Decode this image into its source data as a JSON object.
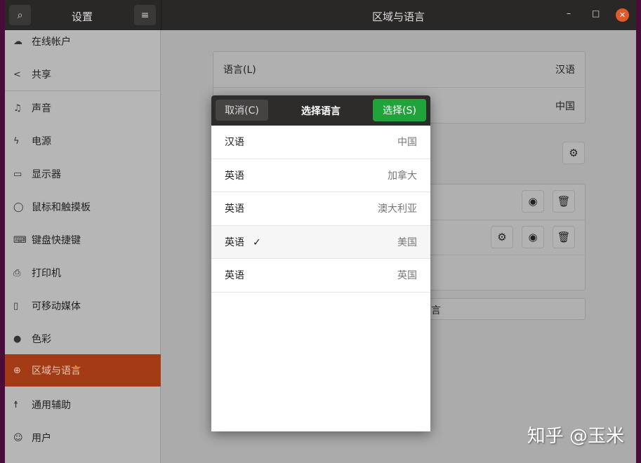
{
  "header": {
    "sidebar_title": "设置",
    "title": "区域与语言",
    "minimize": "–",
    "maximize": "□",
    "close": "✕"
  },
  "sidebar": {
    "items": [
      {
        "label": "在线帐户",
        "icon": "cloud-icon",
        "glyph": "☁"
      },
      {
        "label": "共享",
        "icon": "share-icon",
        "glyph": "<"
      },
      {
        "label": "声音",
        "icon": "music-note-icon",
        "glyph": "♫"
      },
      {
        "label": "电源",
        "icon": "power-icon",
        "glyph": "ϟ"
      },
      {
        "label": "显示器",
        "icon": "display-icon",
        "glyph": "▭"
      },
      {
        "label": "鼠标和触摸板",
        "icon": "mouse-icon",
        "glyph": "◯"
      },
      {
        "label": "键盘快捷键",
        "icon": "keyboard-icon",
        "glyph": "⌨"
      },
      {
        "label": "打印机",
        "icon": "printer-icon",
        "glyph": "⎙"
      },
      {
        "label": "可移动媒体",
        "icon": "removable-media-icon",
        "glyph": "▯"
      },
      {
        "label": "色彩",
        "icon": "color-icon",
        "glyph": "●"
      },
      {
        "label": "区域与语言",
        "icon": "globe-icon",
        "glyph": "⊕",
        "selected": true
      },
      {
        "label": "通用辅助",
        "icon": "accessibility-icon",
        "glyph": "☨"
      },
      {
        "label": "用户",
        "icon": "user-icon",
        "glyph": "☺"
      }
    ]
  },
  "main": {
    "language_label": "语言(L)",
    "language_value": "汉语",
    "format_value": "中国",
    "partial_button": "言"
  },
  "dialog": {
    "cancel": "取消(C)",
    "title": "选择语言",
    "select": "选择(S)",
    "items": [
      {
        "language": "汉语",
        "region": "中国"
      },
      {
        "language": "英语",
        "region": "加拿大"
      },
      {
        "language": "英语",
        "region": "澳大利亚"
      },
      {
        "language": "英语",
        "region": "美国",
        "checked": true,
        "check": "✓"
      },
      {
        "language": "英语",
        "region": "英国"
      }
    ]
  },
  "watermark": "知乎 @玉米",
  "colors": {
    "accent": "#a33c16",
    "select_button": "#1fa33a",
    "close_button": "#e05a2b"
  }
}
